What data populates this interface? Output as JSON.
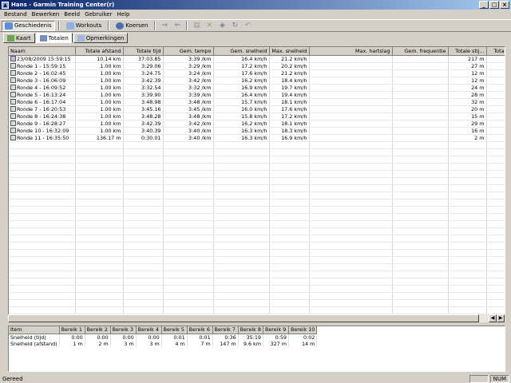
{
  "window": {
    "title": "Hans - Garmin Training Center(r)"
  },
  "menu": [
    "Bestand",
    "Bewerken",
    "Beeld",
    "Gebruiker",
    "Help"
  ],
  "toolbar": {
    "tabs": [
      {
        "label": "Geschiedenis",
        "icon": "history-icon"
      },
      {
        "label": "Workouts",
        "icon": "workouts-icon"
      },
      {
        "label": "Koersen",
        "icon": "courses-icon"
      }
    ]
  },
  "subtabs": [
    {
      "label": "Kaart",
      "icon": "map-icon"
    },
    {
      "label": "Totalen",
      "icon": "totals-icon"
    },
    {
      "label": "Opmerkingen",
      "icon": "notes-icon"
    }
  ],
  "grid": {
    "headers": [
      "Naam",
      "Totale afstand",
      "Totale tijd",
      "Gem. tempo",
      "Gem. snelheid",
      "Max. snelheid",
      "Max. hartslag",
      "Gem. frequentie",
      "Totale stij...",
      "Tota"
    ],
    "rows": [
      [
        "23/08/2009 15:59:15",
        "10.14 km",
        "37:03.85",
        "3:39 /km",
        "16.4 km/h",
        "21.2 km/h",
        "",
        "",
        "217 m",
        ""
      ],
      [
        "Ronde 1 - 15:59:15",
        "1.00 km",
        "3:29.06",
        "3:29 /km",
        "17.2 km/h",
        "20.2 km/h",
        "",
        "",
        "27 m",
        ""
      ],
      [
        "Ronde 2 - 16:02:45",
        "1.00 km",
        "3:24.75",
        "3:24 /km",
        "17.6 km/h",
        "21.2 km/h",
        "",
        "",
        "12 m",
        ""
      ],
      [
        "Ronde 3 - 16:06:09",
        "1.00 km",
        "3:42.39",
        "3:42 /km",
        "16.2 km/h",
        "18.4 km/h",
        "",
        "",
        "12 m",
        ""
      ],
      [
        "Ronde 4 - 16:09:52",
        "1.00 km",
        "3:32.54",
        "3:32 /km",
        "16.9 km/h",
        "19.7 km/h",
        "",
        "",
        "24 m",
        ""
      ],
      [
        "Ronde 5 - 16:13:24",
        "1.00 km",
        "3:39.90",
        "3:39 /km",
        "16.4 km/h",
        "19.4 km/h",
        "",
        "",
        "28 m",
        ""
      ],
      [
        "Ronde 6 - 16:17:04",
        "1.00 km",
        "3:48.98",
        "3:48 /km",
        "15.7 km/h",
        "18.1 km/h",
        "",
        "",
        "32 m",
        ""
      ],
      [
        "Ronde 7 - 16:20:53",
        "1.00 km",
        "3:45.16",
        "3:45 /km",
        "16.0 km/h",
        "17.6 km/h",
        "",
        "",
        "20 m",
        ""
      ],
      [
        "Ronde 8 - 16:24:38",
        "1.00 km",
        "3:48.28",
        "3:48 /km",
        "15.8 km/h",
        "17.2 km/h",
        "",
        "",
        "15 m",
        ""
      ],
      [
        "Ronde 9 - 16:28:27",
        "1.00 km",
        "3:42.39",
        "3:42 /km",
        "16.2 km/h",
        "18.1 km/h",
        "",
        "",
        "29 m",
        ""
      ],
      [
        "Ronde 10 - 16:32:09",
        "1.00 km",
        "3:40.39",
        "3:40 /km",
        "16.3 km/h",
        "18.3 km/h",
        "",
        "",
        "16 m",
        ""
      ],
      [
        "Ronde 11 - 16:35:50",
        "136.17 m",
        "0:30.01",
        "3:40 /km",
        "16.3 km/h",
        "16.9 km/h",
        "",
        "",
        "2 m",
        ""
      ]
    ]
  },
  "zones": {
    "headers": [
      "Item",
      "Bereik 1",
      "Bereik 2",
      "Bereik 3",
      "Bereik 4",
      "Bereik 5",
      "Bereik 6",
      "Bereik 7",
      "Bereik 8",
      "Bereik 9",
      "Bereik 10"
    ],
    "rows": [
      [
        "Snelheid (tijd)",
        "0:00",
        "0:00",
        "0:00",
        "0:00",
        "0:01",
        "0:01",
        "0:36",
        "35:19",
        "0:59",
        "0:02"
      ],
      [
        "Snelheid (afstand)",
        "1 m",
        "2 m",
        "3 m",
        "3 m",
        "4 m",
        "7 m",
        "147 m",
        "9.6 km",
        "327 m",
        "14 m"
      ]
    ]
  },
  "status": {
    "message": "Gereed",
    "num": "NUM"
  }
}
